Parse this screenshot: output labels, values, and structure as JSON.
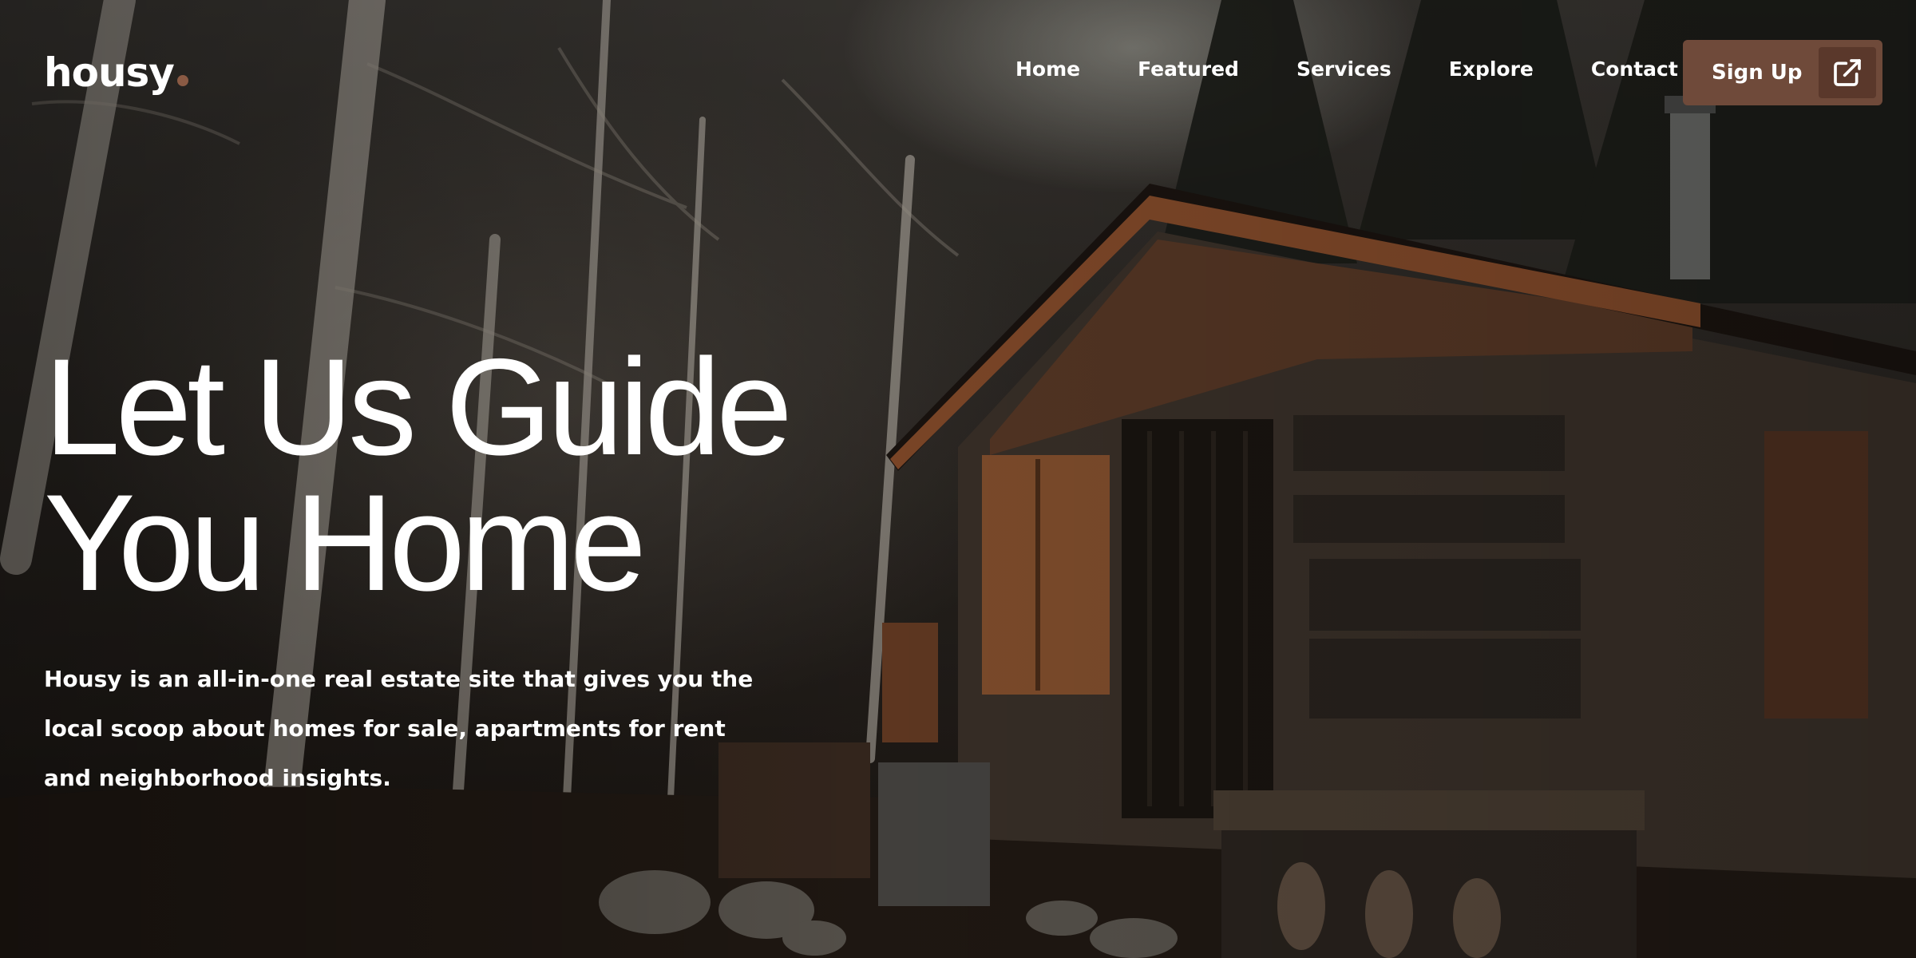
{
  "brand": {
    "name": "housy",
    "dot_color": "#8a5a44"
  },
  "nav": {
    "items": [
      {
        "label": "Home"
      },
      {
        "label": "Featured"
      },
      {
        "label": "Services"
      },
      {
        "label": "Explore"
      },
      {
        "label": "Contact"
      }
    ],
    "signup": {
      "label": "Sign Up",
      "icon": "external-link-icon",
      "color": "#6f4a3a",
      "icon_bg": "#5a382b"
    }
  },
  "hero": {
    "headline_line1": "Let Us Guide",
    "headline_line2": "You Home",
    "subtitle_line1": "Housy is an all-in-one real estate site that gives you the",
    "subtitle_line2": "local scoop about homes for sale, apartments for rent",
    "subtitle_line3": "and neighborhood insights."
  }
}
